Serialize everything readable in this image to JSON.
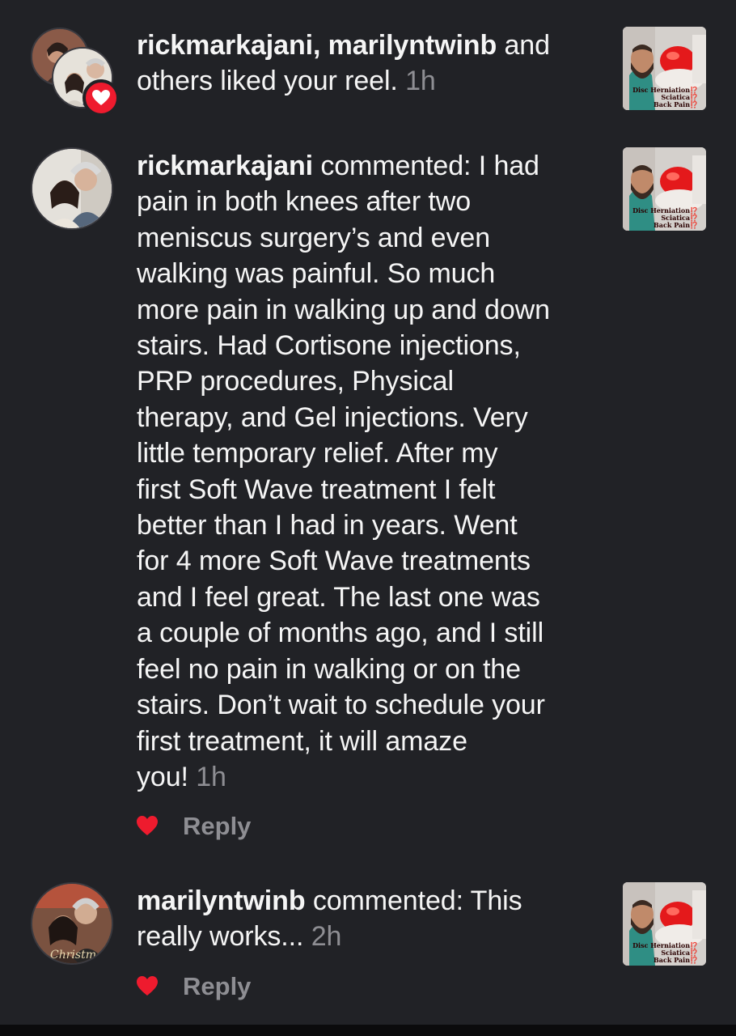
{
  "notifications": [
    {
      "type": "like",
      "users_bold": "rickmarkajani, marilyntwinb",
      "text": " and others liked your reel. ",
      "time": "1h",
      "thumbnail_caption": [
        "Disc Herniation⁉️",
        "Sciatica⁉️",
        "Back Pain⁉️"
      ]
    },
    {
      "type": "comment",
      "user": "rickmarkajani",
      "verb": " commented: ",
      "comment_lines": [
        "I had",
        "pain in both knees after two",
        "meniscus surgery’s and even",
        "walking was painful. So much",
        "more pain in walking up and down",
        "stairs. Had Cortisone injections,",
        "PRP procedures, Physical",
        "therapy, and Gel injections. Very",
        "little temporary relief. After my",
        "first Soft Wave treatment I felt",
        "better than I had in years. Went",
        "for 4 more Soft Wave treatments",
        "and I feel great. The last one was",
        "a couple of months ago, and I still",
        "feel no pain in walking or on the",
        "stairs. Don’t wait to schedule your",
        "first treatment, it will amaze",
        "you!"
      ],
      "time": "1h",
      "reply_label": "Reply",
      "thumbnail_caption": [
        "Disc Herniation⁉️",
        "Sciatica⁉️",
        "Back Pain⁉️"
      ]
    },
    {
      "type": "comment",
      "user": "marilyntwinb",
      "verb": " commented: ",
      "comment_lines": [
        "This",
        "really works..."
      ],
      "time": "2h",
      "reply_label": "Reply",
      "avatar_text": "Christmas",
      "thumbnail_caption": [
        "Disc Herniation⁉️",
        "Sciatica⁉️",
        "Back Pain⁉️"
      ]
    }
  ],
  "colors": {
    "background": "#212226",
    "text": "#f5f5f5",
    "muted": "#8e8e93",
    "heart_red": "#ee1b2e"
  }
}
